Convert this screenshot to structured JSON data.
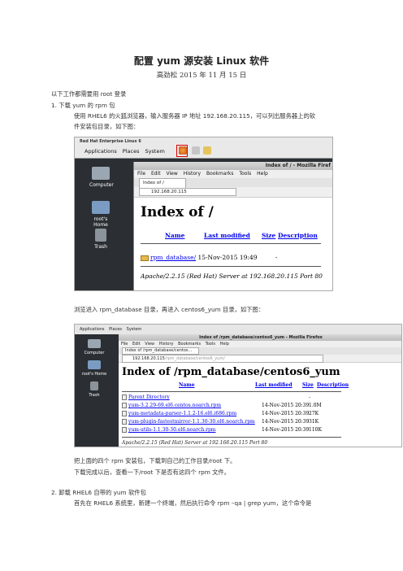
{
  "doc": {
    "title": "配置 yum 源安装 Linux 软件",
    "author_line": "高劲松   2015 年 11 月 15 日",
    "intro": "以下工作都需要用 root 登录",
    "step1_heading": "1.    下载 yum 的 rpm 包",
    "step1_line1": "使用 RHEL6 的火狐浏览器，输入服务器 IP 地址 192.168.20.115，可以列出服务器上的软",
    "step1_line2": "件安装包目录，如下图：",
    "after_shot1": "浏览进入 rpm_database 目录，再进入 centos6_yum 目录，如下图：",
    "after_shot2_line1": "把上面的四个 rpm 安装包，下载到自己的工作目录/root 下。",
    "after_shot2_line2": "下载完成以后，查看一下/root 下是否有这四个 rpm 文件。",
    "step2_heading": "2.    卸载 RHEL6 自带的 yum 软件包",
    "step2_line1": "首先在 RHEL6 系统里，新建一个终端，然后执行命令 rpm    –qa | grep yum，这个命令是"
  },
  "shot1": {
    "os_title": "Red Hat Enterprise Linux 6",
    "menu": [
      "Applications",
      "Places",
      "System"
    ],
    "desktop_icons": [
      {
        "name": "computer",
        "label": "Computer"
      },
      {
        "name": "home",
        "label": "root's Home"
      },
      {
        "name": "trash",
        "label": "Trash"
      }
    ],
    "window_title": "Index of / - Mozilla Firef",
    "browser_menu": [
      "File",
      "Edit",
      "View",
      "History",
      "Bookmarks",
      "Tools",
      "Help"
    ],
    "tab_label": "Index of /",
    "url": "192.168.20.115",
    "heading": "Index of /",
    "col_name": "Name",
    "col_modified": "Last modified",
    "col_size": "Size",
    "col_desc": "Description",
    "row_name": "rpm_database/",
    "row_date": "15-Nov-2015 19:49",
    "row_size": "-",
    "server_line": "Apache/2.2.15 (Red Hat) Server at 192.168.20.115 Port 80"
  },
  "shot2": {
    "menu": [
      "Applications",
      "Places",
      "System"
    ],
    "desktop_icons": [
      {
        "name": "computer",
        "label": "Computer"
      },
      {
        "name": "home",
        "label": "root's Home"
      },
      {
        "name": "trash",
        "label": "Trash"
      }
    ],
    "window_title": "Index of /rpm_database/centos6_yum - Mozilla Firefox",
    "browser_menu": [
      "File",
      "Edit",
      "View",
      "History",
      "Bookmarks",
      "Tools",
      "Help"
    ],
    "tab_label": "Index of /rpm_database/centos...",
    "url_main": "192.168.20.115",
    "url_rest": "/rpm_database/centos6_yum/",
    "heading": "Index of /rpm_database/centos6_yum",
    "col_name": "Name",
    "col_modified": "Last modified",
    "col_size": "Size",
    "col_desc": "Description",
    "rows": [
      {
        "name": "Parent Directory",
        "modified": "",
        "size": "-"
      },
      {
        "name": "yum-3.2.29-69.el6.centos.noarch.rpm",
        "modified": "14-Nov-2015 20:39",
        "size": "1.0M"
      },
      {
        "name": "yum-metadata-parser-1.1.2-16.el6.i686.rpm",
        "modified": "14-Nov-2015 20:39",
        "size": "27K"
      },
      {
        "name": "yum-plugin-fastestmirror-1.1.30-30.el6.noarch.rpm",
        "modified": "14-Nov-2015 20:39",
        "size": "31K"
      },
      {
        "name": "yum-utils-1.1.30-30.el6.noarch.rpm",
        "modified": "14-Nov-2015 20:39",
        "size": "110K"
      }
    ],
    "server_line": "Apache/2.2.15 (Red Hat) Server at 192.168.20.115 Port 80"
  }
}
